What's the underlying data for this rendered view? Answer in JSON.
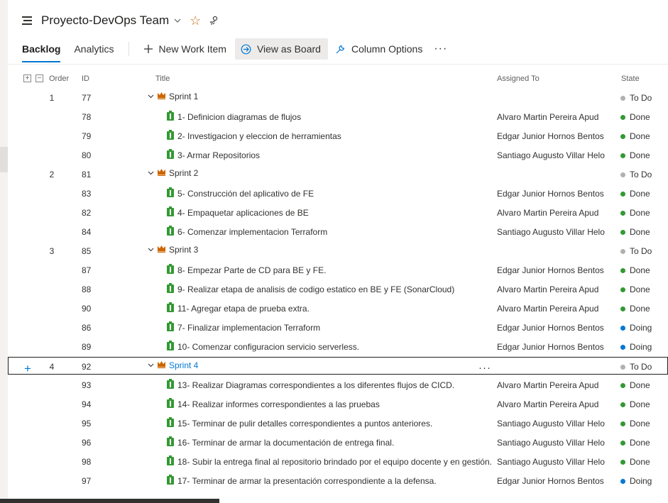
{
  "header": {
    "team_name": "Proyecto-DevOps Team"
  },
  "toolbar": {
    "tab_backlog": "Backlog",
    "tab_analytics": "Analytics",
    "new_work_item": "New Work Item",
    "view_as_board": "View as Board",
    "column_options": "Column Options",
    "more": "···"
  },
  "columns": {
    "order": "Order",
    "id": "ID",
    "title": "Title",
    "assigned": "Assigned To",
    "state": "State"
  },
  "colors": {
    "todo": "#b3b0ad",
    "done": "#339933",
    "doing": "#0078d4",
    "accent": "#0078d4",
    "crown": "#cc6600",
    "pbi": "#339933"
  },
  "rows": [
    {
      "order": "1",
      "id": "77",
      "title": "Sprint 1",
      "assigned": "",
      "state": "To Do",
      "type": "feature"
    },
    {
      "order": "",
      "id": "78",
      "title": "1- Definicion diagramas de flujos",
      "assigned": "Alvaro Martin Pereira Apud",
      "state": "Done",
      "type": "pbi"
    },
    {
      "order": "",
      "id": "79",
      "title": "2- Investigacion y eleccion de herramientas",
      "assigned": "Edgar Junior Hornos Bentos",
      "state": "Done",
      "type": "pbi"
    },
    {
      "order": "",
      "id": "80",
      "title": "3- Armar Repositorios",
      "assigned": "Santiago Augusto Villar Helo",
      "state": "Done",
      "type": "pbi"
    },
    {
      "order": "2",
      "id": "81",
      "title": "Sprint 2",
      "assigned": "",
      "state": "To Do",
      "type": "feature"
    },
    {
      "order": "",
      "id": "83",
      "title": "5- Construcción del aplicativo de FE",
      "assigned": "Edgar Junior Hornos Bentos",
      "state": "Done",
      "type": "pbi"
    },
    {
      "order": "",
      "id": "82",
      "title": "4- Empaquetar aplicaciones de BE",
      "assigned": "Alvaro Martin Pereira Apud",
      "state": "Done",
      "type": "pbi"
    },
    {
      "order": "",
      "id": "84",
      "title": "6- Comenzar implementacion Terraform",
      "assigned": "Santiago Augusto Villar Helo",
      "state": "Done",
      "type": "pbi"
    },
    {
      "order": "3",
      "id": "85",
      "title": "Sprint 3",
      "assigned": "",
      "state": "To Do",
      "type": "feature"
    },
    {
      "order": "",
      "id": "87",
      "title": "8- Empezar Parte de CD para BE y FE.",
      "assigned": "Edgar Junior Hornos Bentos",
      "state": "Done",
      "type": "pbi"
    },
    {
      "order": "",
      "id": "88",
      "title": "9- Realizar etapa de analisis de codigo estatico en BE y FE (SonarCloud)",
      "assigned": "Alvaro Martin Pereira Apud",
      "state": "Done",
      "type": "pbi"
    },
    {
      "order": "",
      "id": "90",
      "title": "11- Agregar etapa de prueba extra.",
      "assigned": "Alvaro Martin Pereira Apud",
      "state": "Done",
      "type": "pbi"
    },
    {
      "order": "",
      "id": "86",
      "title": "7- Finalizar implementacion Terraform",
      "assigned": "Edgar Junior Hornos Bentos",
      "state": "Doing",
      "type": "pbi"
    },
    {
      "order": "",
      "id": "89",
      "title": "10- Comenzar configuracion servicio serverless.",
      "assigned": "Edgar Junior Hornos Bentos",
      "state": "Doing",
      "type": "pbi"
    },
    {
      "order": "4",
      "id": "92",
      "title": "Sprint 4",
      "assigned": "",
      "state": "To Do",
      "type": "feature",
      "selected": true
    },
    {
      "order": "",
      "id": "93",
      "title": "13- Realizar Diagramas correspondientes a los diferentes flujos de CICD.",
      "assigned": "Alvaro Martin Pereira Apud",
      "state": "Done",
      "type": "pbi"
    },
    {
      "order": "",
      "id": "94",
      "title": "14- Realizar informes correspondientes a las pruebas",
      "assigned": "Alvaro Martin Pereira Apud",
      "state": "Done",
      "type": "pbi"
    },
    {
      "order": "",
      "id": "95",
      "title": "15- Terminar de pulir detalles correspondientes a puntos anteriores.",
      "assigned": "Santiago Augusto Villar Helo",
      "state": "Done",
      "type": "pbi"
    },
    {
      "order": "",
      "id": "96",
      "title": "16- Terminar de armar la documentación de entrega final.",
      "assigned": "Santiago Augusto Villar Helo",
      "state": "Done",
      "type": "pbi"
    },
    {
      "order": "",
      "id": "98",
      "title": "18- Subir la entrega final al repositorio brindado por el equipo docente y en gestión.",
      "assigned": "Santiago Augusto Villar Helo",
      "state": "Done",
      "type": "pbi"
    },
    {
      "order": "",
      "id": "97",
      "title": "17- Terminar de armar la presentación correspondiente a la defensa.",
      "assigned": "Edgar Junior Hornos Bentos",
      "state": "Doing",
      "type": "pbi"
    }
  ]
}
